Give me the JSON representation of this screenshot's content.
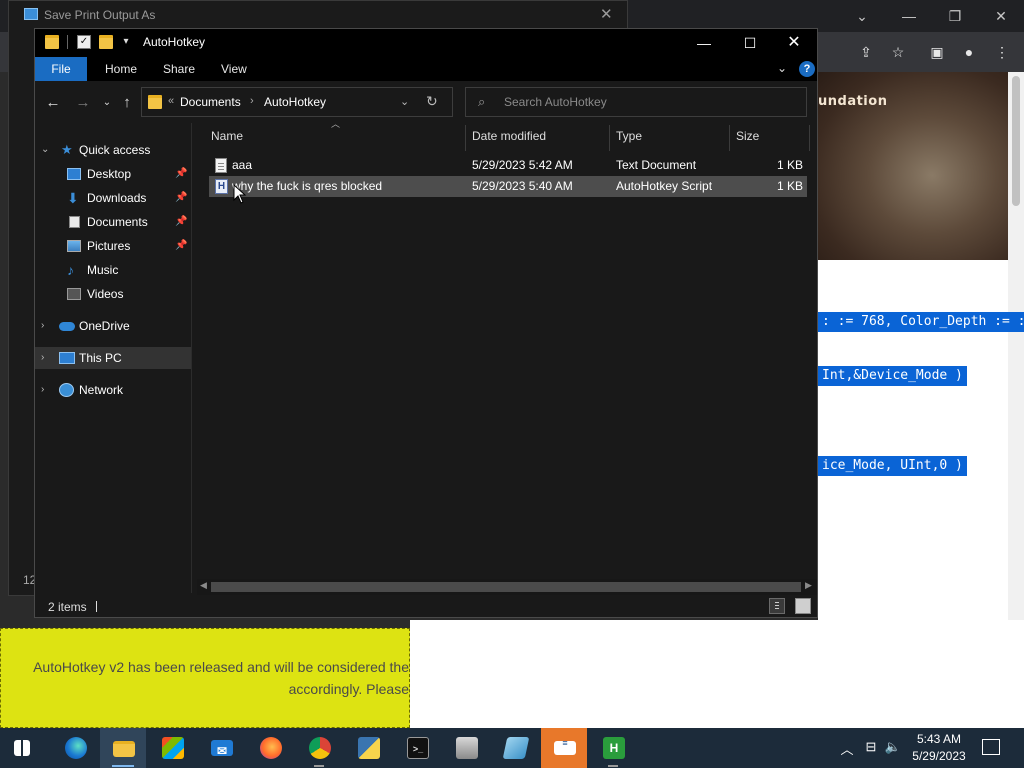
{
  "print_dialog": {
    "title": "Save Print Output As",
    "side_number": "12"
  },
  "browser": {
    "hero_title": "undation",
    "code_lines": [
      ": := 768, Color_Depth := :",
      "Int,&Device_Mode )",
      "ice_Mode, UInt,0 )"
    ]
  },
  "banner": {
    "line1": "AutoHotkey v2 has been released and will be considered the",
    "line2": "accordingly. Please"
  },
  "explorer": {
    "title": "AutoHotkey",
    "ribbon_tabs": [
      "File",
      "Home",
      "Share",
      "View"
    ],
    "address": {
      "prefix": "«",
      "crumbs": [
        "Documents",
        "AutoHotkey"
      ]
    },
    "search_placeholder": "Search AutoHotkey",
    "nav": {
      "quick_access": "Quick access",
      "desktop": "Desktop",
      "downloads": "Downloads",
      "documents": "Documents",
      "pictures": "Pictures",
      "music": "Music",
      "videos": "Videos",
      "onedrive": "OneDrive",
      "this_pc": "This PC",
      "network": "Network"
    },
    "columns": {
      "name": "Name",
      "date": "Date modified",
      "type": "Type",
      "size": "Size"
    },
    "files": [
      {
        "name": "aaa",
        "date": "5/29/2023 5:42 AM",
        "type": "Text Document",
        "size": "1 KB",
        "icon": "text-file-icon"
      },
      {
        "name": "why the fuck is qres blocked",
        "date": "5/29/2023 5:40 AM",
        "type": "AutoHotkey Script",
        "size": "1 KB",
        "icon": "ahk-script-icon"
      }
    ],
    "status": {
      "count": "2 items"
    }
  },
  "taskbar": {
    "apps": [
      "start",
      "edge",
      "file-explorer",
      "store",
      "mail",
      "firefox",
      "chrome",
      "python",
      "terminal",
      "app-a",
      "app-b",
      "notes",
      "ahk"
    ],
    "clock_time": "5:43 AM",
    "clock_date": "5/29/2023"
  },
  "colors": {
    "accent": "#1a6cc2",
    "selection": "#4d4d4d",
    "code_highlight": "#0a64d6",
    "banner": "#dde312"
  }
}
